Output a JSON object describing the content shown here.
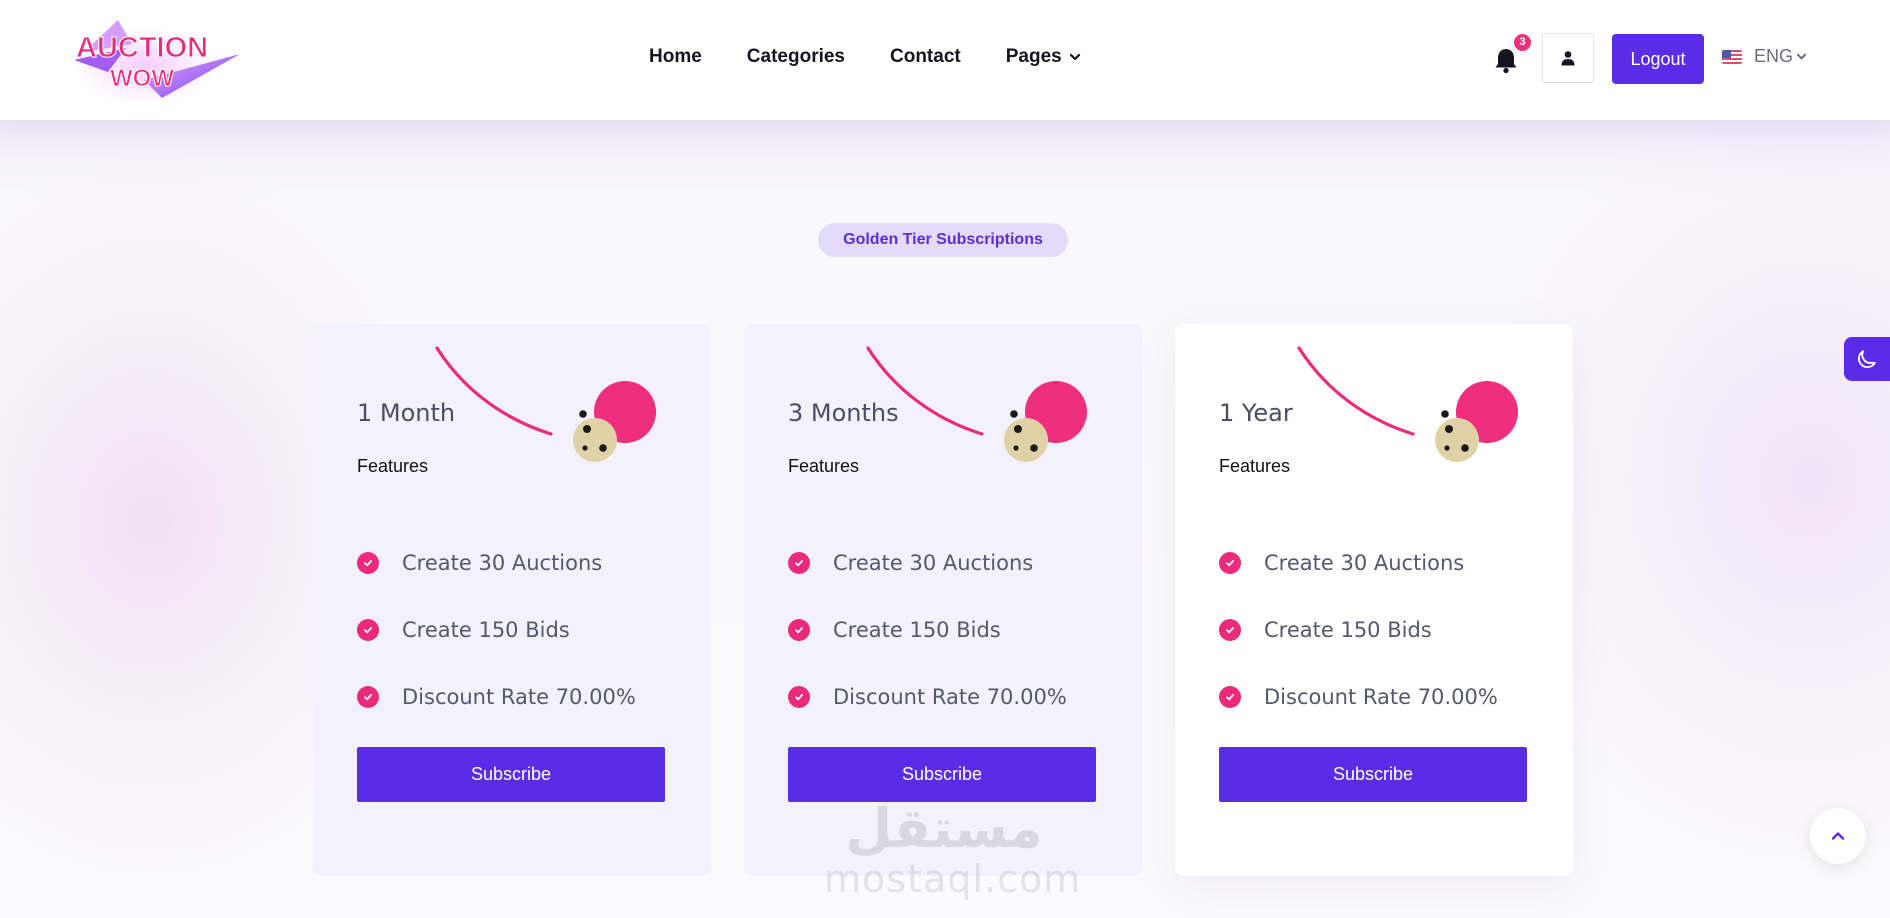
{
  "header": {
    "logo_text": "AUCTION WOW",
    "nav": [
      {
        "label": "Home"
      },
      {
        "label": "Categories"
      },
      {
        "label": "Contact"
      },
      {
        "label": "Pages"
      }
    ],
    "notification_count": "3",
    "logout_label": "Logout",
    "language": "ENG"
  },
  "section": {
    "tag": "Golden Tier Subscriptions"
  },
  "plans": [
    {
      "title": "1 Month",
      "features_label": "Features",
      "features": [
        "Create 30 Auctions",
        "Create 150 Bids",
        "Discount Rate 70.00%"
      ],
      "button": "Subscribe"
    },
    {
      "title": "3 Months",
      "features_label": "Features",
      "features": [
        "Create 30 Auctions",
        "Create 150 Bids",
        "Discount Rate 70.00%"
      ],
      "button": "Subscribe"
    },
    {
      "title": "1 Year",
      "features_label": "Features",
      "features": [
        "Create 30 Auctions",
        "Create 150 Bids",
        "Discount Rate 70.00%"
      ],
      "button": "Subscribe"
    }
  ],
  "watermark": {
    "arabic": "مستقل",
    "latin": "mostaql.com"
  },
  "colors": {
    "primary": "#5b2ce8",
    "accent_pink": "#ec2a7b",
    "tag_bg": "#e3dafc",
    "card_tint": "#f3f2fc"
  },
  "icons": [
    "bell-icon",
    "user-icon",
    "chevron-down-icon",
    "us-flag-icon",
    "moon-icon",
    "arrow-up-icon",
    "check-icon"
  ]
}
